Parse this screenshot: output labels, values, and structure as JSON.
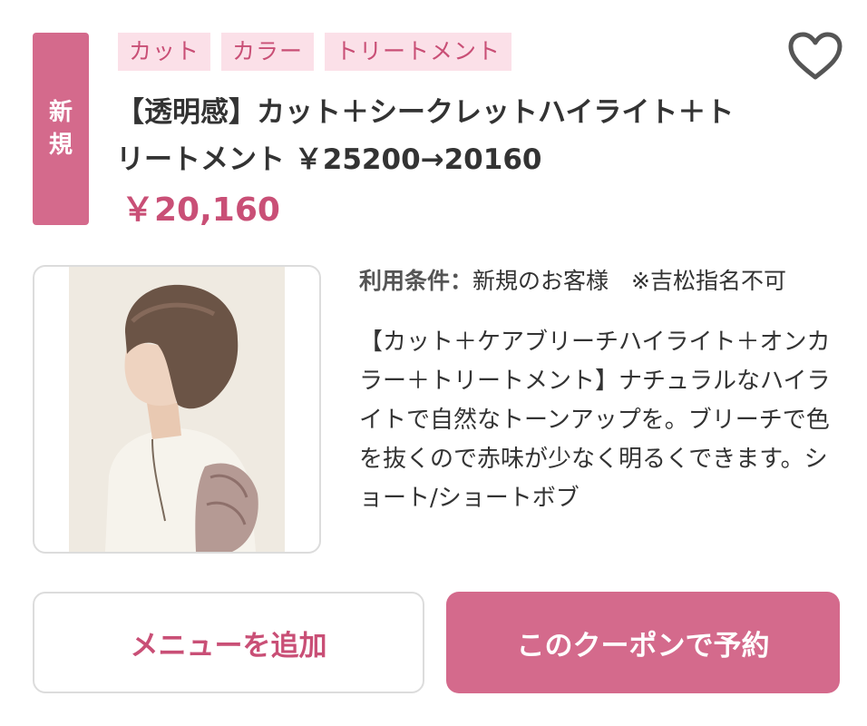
{
  "badge": {
    "line1": "新",
    "line2": "規"
  },
  "tags": [
    "カット",
    "カラー",
    "トリートメント"
  ],
  "favorite_icon": "heart-outline-icon",
  "title": "【透明感】カット＋シークレットハイライト＋トリートメント ￥25200→20160",
  "price": "￥20,160",
  "conditions": {
    "label": "利用条件：",
    "value": "新規のお客様　※吉松指名不可"
  },
  "description": "【カット＋ケアブリーチハイライト＋オンカラー＋トリートメント】ナチュラルなハイライトで自然なトーンアップを。ブリーチで色を抜くので赤味が少なく明るくできます。ショート/ショートボブ",
  "buttons": {
    "add_menu": "メニューを追加",
    "reserve": "このクーポンで予約"
  },
  "colors": {
    "accent": "#d46a8c",
    "accent_text": "#c94f76",
    "tag_bg": "#fbe0e8"
  }
}
